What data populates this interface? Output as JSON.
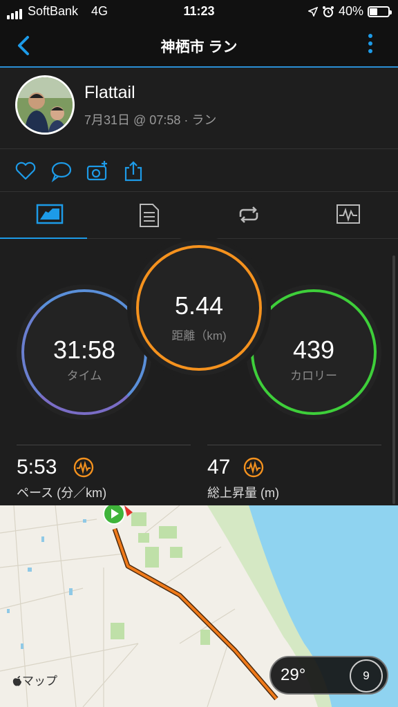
{
  "status_bar": {
    "carrier": "SoftBank",
    "network": "4G",
    "time": "11:23",
    "battery": "40%",
    "battery_level": 0.4
  },
  "nav": {
    "title": "神栖市 ラン",
    "back_icon": "chevron-left-icon",
    "more_icon": "more-vertical-icon"
  },
  "profile": {
    "name": "Flattail",
    "meta": "7月31日 @ 07:58 · ラン"
  },
  "actions": [
    "heart-icon",
    "comment-icon",
    "add-photo-icon",
    "share-icon"
  ],
  "tabs": [
    "summary-icon",
    "details-icon",
    "laps-icon",
    "chart-icon"
  ],
  "stats": {
    "time": {
      "value": "31:58",
      "label": "タイム"
    },
    "distance": {
      "value": "5.44",
      "label": "距離（km)"
    },
    "calories": {
      "value": "439",
      "label": "カロリー"
    },
    "pace": {
      "value": "5:53",
      "label": "ペース (分／km)"
    },
    "elevation": {
      "value": "47",
      "label": "総上昇量 (m)"
    }
  },
  "map": {
    "attribution": "マップ",
    "temperature": "29°",
    "wind": "9"
  },
  "colors": {
    "accent": "#1d9be8",
    "time_ring": "#5a8fd9",
    "distance_ring": "#f5921e",
    "calories_ring": "#3ecf3a",
    "route": "#f07a1a"
  }
}
